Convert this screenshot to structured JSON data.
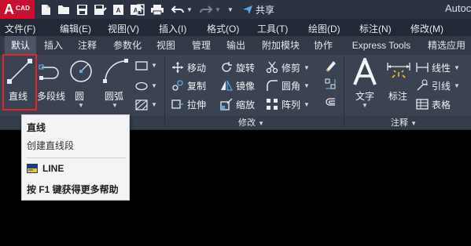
{
  "title_bar": {
    "logo_letter": "A",
    "logo_sub": "CAD",
    "share_label": "共享",
    "app_title": "Autoc",
    "quick_access_icons": [
      "new-file-icon",
      "open-folder-icon",
      "save-icon",
      "save-as-icon",
      "open-web-icon",
      "save-web-icon",
      "export-icon",
      "print-icon",
      "undo-icon",
      "redo-icon",
      "share-icon"
    ]
  },
  "menu_bar": {
    "items": [
      "文件(F)",
      "编辑(E)",
      "视图(V)",
      "插入(I)",
      "格式(O)",
      "工具(T)",
      "绘图(D)",
      "标注(N)",
      "修改(M)"
    ]
  },
  "ribbon_tabs": {
    "items": [
      "默认",
      "插入",
      "注释",
      "参数化",
      "视图",
      "管理",
      "输出",
      "附加模块",
      "协作",
      "Express Tools",
      "精选应用"
    ],
    "active": "默认"
  },
  "draw_panel": {
    "line": "直线",
    "polyline": "多段线",
    "circle": "圆",
    "arc": "圆弧"
  },
  "modify_panel": {
    "title": "修改",
    "move": "移动",
    "rotate": "旋转",
    "trim": "修剪",
    "copy": "复制",
    "mirror": "镜像",
    "fillet": "圆角",
    "stretch": "拉伸",
    "scale": "缩放",
    "array": "阵列"
  },
  "annotation_panel": {
    "title": "注释",
    "text": "文字",
    "dimension": "标注",
    "linear": "线性",
    "leader": "引线",
    "table": "表格"
  },
  "tooltip": {
    "title": "直线",
    "description": "创建直线段",
    "command": "LINE",
    "help": "按 F1 键获得更多帮助"
  },
  "colors": {
    "accent_red": "#e3262a",
    "ribbon_bg": "#3b4353",
    "canvas_bg": "#000000"
  }
}
